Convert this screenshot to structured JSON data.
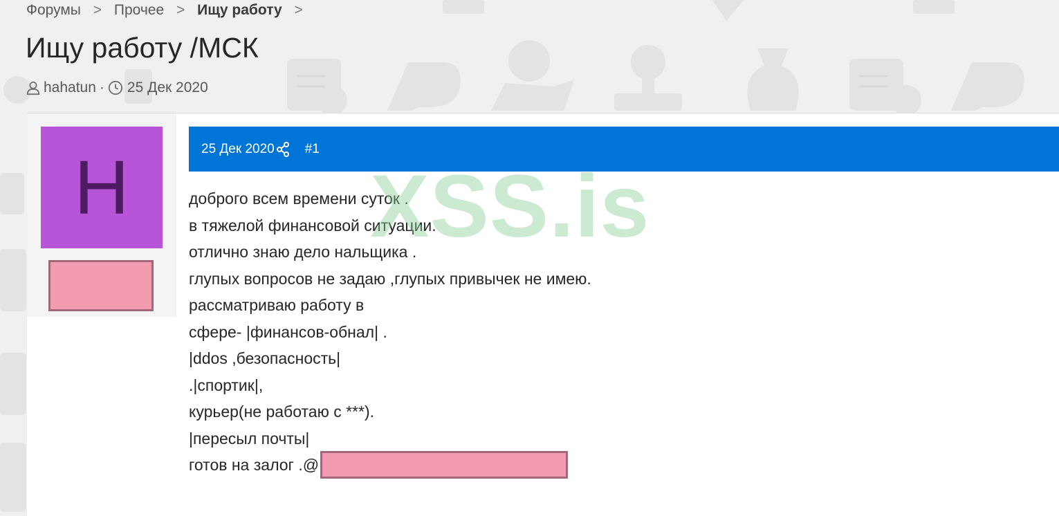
{
  "breadcrumb": {
    "items": [
      "Форумы",
      "Прочее",
      "Ищу работу"
    ],
    "separator": ">"
  },
  "thread": {
    "title": "Ищу работу /МСК",
    "author": "hahatun",
    "separator": "·",
    "date": "25 Дек 2020"
  },
  "post": {
    "avatar_letter": "H",
    "avatar_color": "#b754d8",
    "header_color": "#0075d8",
    "date": "25 Дек 2020",
    "number": "#1",
    "lines": [
      "доброго всем времени суток .",
      "в тяжелой финансовой ситуации.",
      "отлично знаю дело нальщика .",
      "глупых вопросов не задаю ,глупых привычек не имею.",
      "рассматриваю работу в",
      "сфере- |финансов-обнал| .",
      "|ddos ,безопасность|",
      ".|спортик|,",
      "курьер(не работаю с ***).",
      "|пересыл почты|",
      "готов на залог .@"
    ]
  },
  "watermark": "XSS.is",
  "icons": {
    "author": "user-icon",
    "date": "clock-icon",
    "share": "share-icon"
  }
}
